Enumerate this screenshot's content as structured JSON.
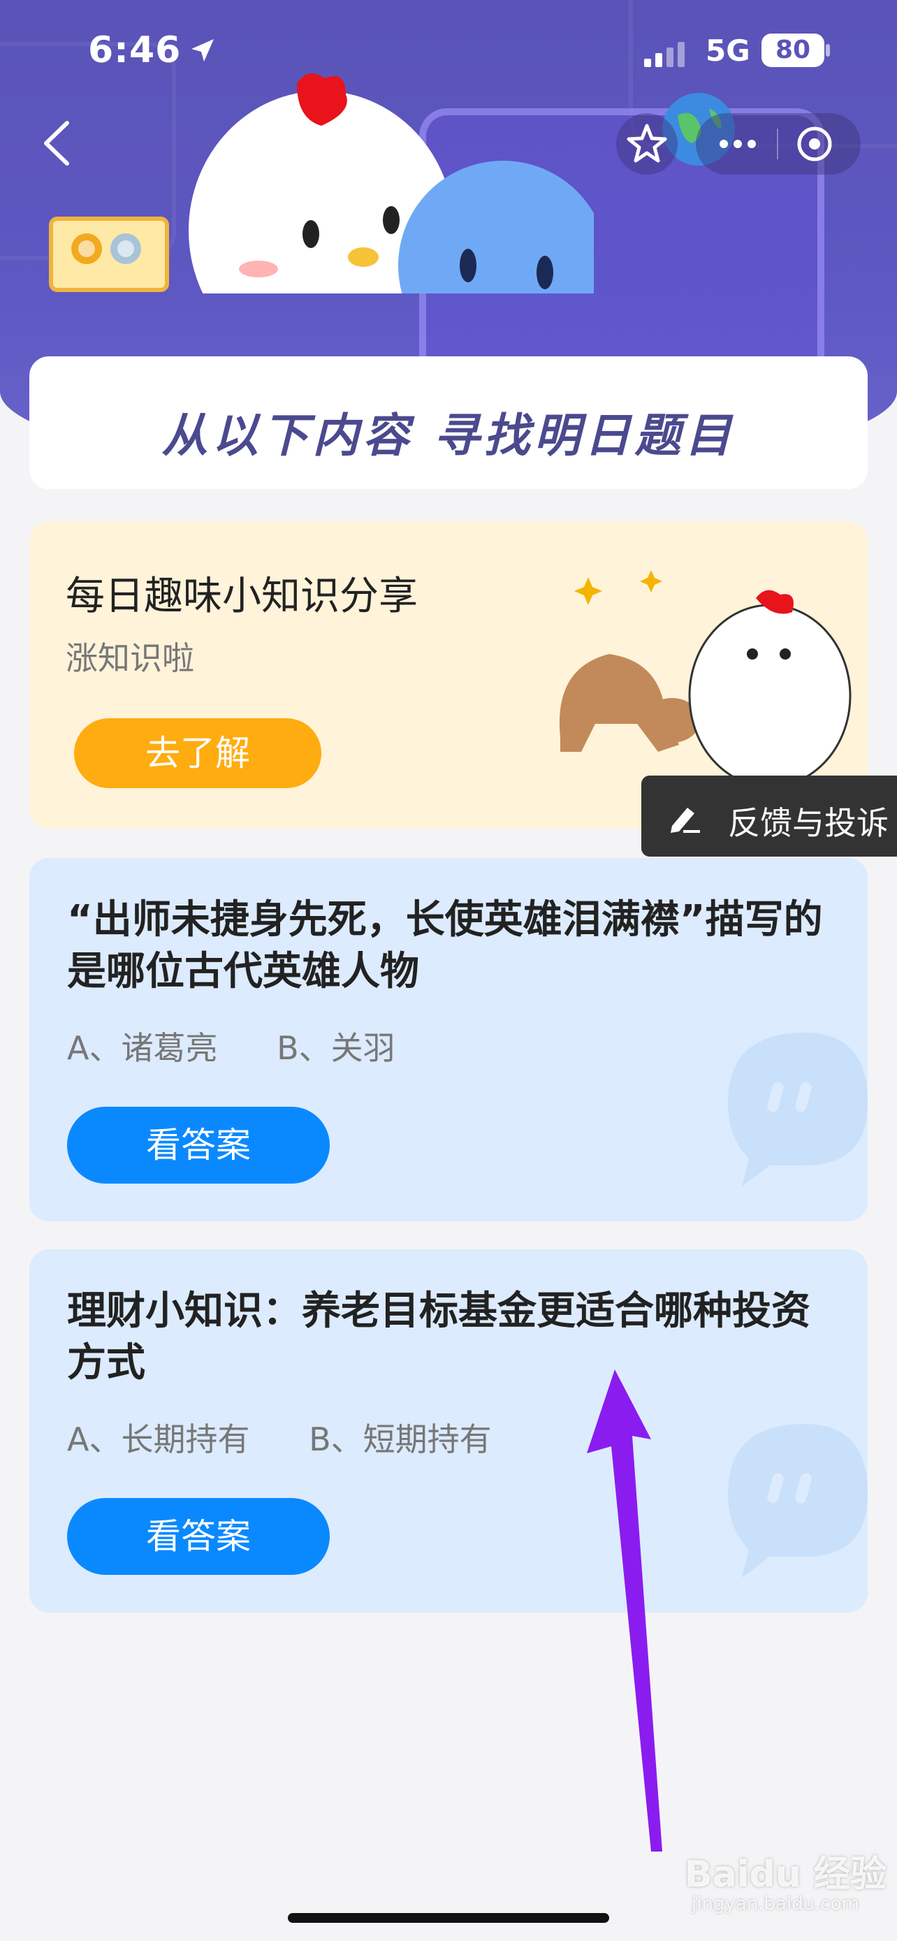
{
  "status": {
    "time": "6:46",
    "network": "5G",
    "battery": "80"
  },
  "banner": {
    "title": "从以下内容 寻找明日题目"
  },
  "promo": {
    "title": "每日趣味小知识分享",
    "subtitle": "涨知识啦",
    "button_label": "去了解"
  },
  "questions": [
    {
      "title": "“出师未捷身先死，长使英雄泪满襟”描写的是哪位古代英雄人物",
      "option_a": "A、诸葛亮",
      "option_b": "B、关羽",
      "button_label": "看答案"
    },
    {
      "title": "理财小知识：养老目标基金更适合哪种投资方式",
      "option_a": "A、长期持有",
      "option_b": "B、短期持有",
      "button_label": "看答案"
    }
  ],
  "feedback": {
    "label": "反馈与投诉",
    "icon": "edit-icon"
  },
  "watermark": {
    "text": "Baidu 经验",
    "sub": "jingyan.baidu.com"
  },
  "colors": {
    "header": "#5a54b8",
    "promo_button": "#ffac10",
    "answer_button": "#0a89ff",
    "annotation_arrow": "#8b1cf0"
  }
}
